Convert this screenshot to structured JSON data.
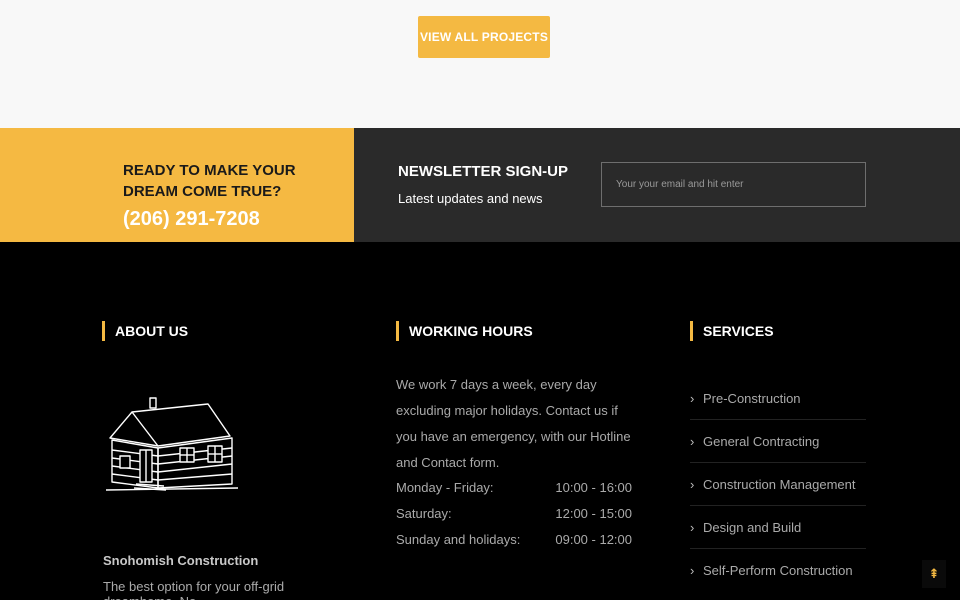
{
  "top": {
    "projects_button": "VIEW ALL PROJECTS"
  },
  "cta": {
    "title": "READY TO MAKE YOUR DREAM COME TRUE?",
    "phone": "(206) 291-7208"
  },
  "newsletter": {
    "title": "NEWSLETTER SIGN-UP",
    "subtitle": "Latest updates and news",
    "placeholder": "Your your email and hit enter"
  },
  "footer": {
    "about": {
      "heading": "ABOUT US",
      "logo": "house-illustration",
      "company": "Snohomish Construction",
      "text": "The best option for your off-grid dreamhome. No"
    },
    "hours": {
      "heading": "WORKING HOURS",
      "text": "We work 7 days a week, every day excluding major holidays. Contact us if you have an emergency, with our Hotline and Contact form.",
      "rows": [
        {
          "day": "Monday - Friday:",
          "time": "10:00 - 16:00"
        },
        {
          "day": "Saturday:",
          "time": "12:00 - 15:00"
        },
        {
          "day": "Sunday and holidays:",
          "time": "09:00 - 12:00"
        }
      ]
    },
    "services": {
      "heading": "SERVICES",
      "items": [
        {
          "label": "Pre-Construction"
        },
        {
          "label": "General Contracting"
        },
        {
          "label": "Construction Management"
        },
        {
          "label": "Design and Build"
        },
        {
          "label": "Self-Perform Construction"
        }
      ]
    }
  },
  "back_to_top": {
    "icon": "double-chevron-up-icon",
    "glyph": "⇞"
  },
  "colors": {
    "accent": "#f4b942",
    "dark_panel": "#2a2a2a",
    "footer_bg": "#000000"
  }
}
